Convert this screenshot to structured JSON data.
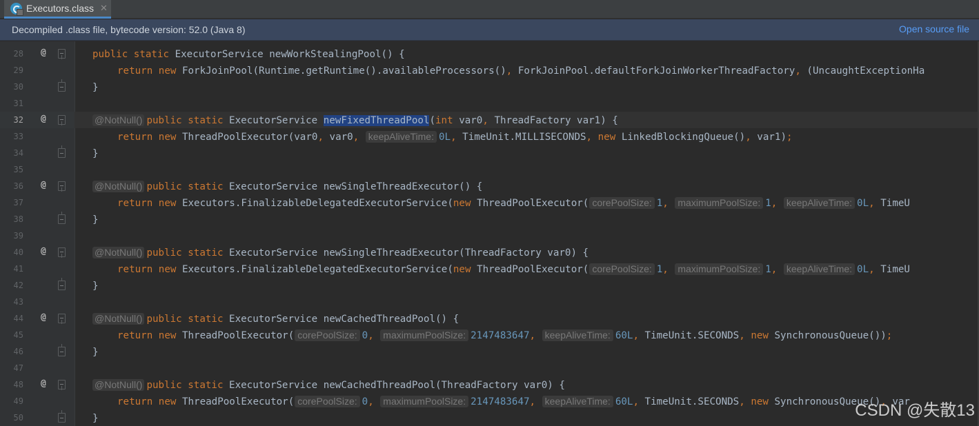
{
  "tab": {
    "title": "Executors.class",
    "close": "✕"
  },
  "banner": {
    "text": "Decompiled .class file, bytecode version: 52.0 (Java 8)",
    "link": "Open source file"
  },
  "watermark": "CSDN @失散13",
  "lines": [
    {
      "n": "28",
      "marker": "@",
      "fold": "open",
      "indent": 0,
      "tokens": [
        {
          "t": "public static ",
          "c": "kw"
        },
        {
          "t": "ExecutorService newWorkStealingPool() {",
          "c": "plain"
        }
      ]
    },
    {
      "n": "29",
      "marker": "",
      "fold": "none",
      "indent": 1,
      "tokens": [
        {
          "t": "return new ",
          "c": "kw"
        },
        {
          "t": "ForkJoinPool(Runtime.getRuntime().availableProcessors()",
          "c": "plain"
        },
        {
          "t": ", ",
          "c": "punct"
        },
        {
          "t": "ForkJoinPool.defaultForkJoinWorkerThreadFactory",
          "c": "plain"
        },
        {
          "t": ", ",
          "c": "punct"
        },
        {
          "t": "(UncaughtExceptionHa",
          "c": "plain"
        }
      ]
    },
    {
      "n": "30",
      "marker": "",
      "fold": "close",
      "indent": 0,
      "tokens": [
        {
          "t": "}",
          "c": "plain"
        }
      ]
    },
    {
      "n": "31",
      "marker": "",
      "fold": "none",
      "indent": 0,
      "tokens": []
    },
    {
      "n": "32",
      "marker": "@",
      "fold": "open",
      "indent": 0,
      "current": true,
      "tokens": [
        {
          "t": "@NotNull()",
          "c": "ann-hint"
        },
        {
          "t": "public static ",
          "c": "kw"
        },
        {
          "t": "ExecutorService ",
          "c": "plain"
        },
        {
          "t": "newFixedThreadPool",
          "c": "sel"
        },
        {
          "t": "(",
          "c": "plain"
        },
        {
          "t": "int ",
          "c": "kw"
        },
        {
          "t": "var0",
          "c": "plain"
        },
        {
          "t": ", ",
          "c": "punct"
        },
        {
          "t": "ThreadFactory var1) {",
          "c": "plain"
        }
      ]
    },
    {
      "n": "33",
      "marker": "",
      "fold": "none",
      "indent": 1,
      "tokens": [
        {
          "t": "return new ",
          "c": "kw"
        },
        {
          "t": "ThreadPoolExecutor(var0",
          "c": "plain"
        },
        {
          "t": ", ",
          "c": "punct"
        },
        {
          "t": "var0",
          "c": "plain"
        },
        {
          "t": ", ",
          "c": "punct"
        },
        {
          "t": "keepAliveTime:",
          "c": "hint"
        },
        {
          "t": "0L",
          "c": "num"
        },
        {
          "t": ", ",
          "c": "punct"
        },
        {
          "t": "TimeUnit.MILLISECONDS",
          "c": "plain"
        },
        {
          "t": ", ",
          "c": "punct"
        },
        {
          "t": "new ",
          "c": "kw"
        },
        {
          "t": "LinkedBlockingQueue()",
          "c": "plain"
        },
        {
          "t": ", ",
          "c": "punct"
        },
        {
          "t": "var1)",
          "c": "plain"
        },
        {
          "t": ";",
          "c": "punct"
        }
      ]
    },
    {
      "n": "34",
      "marker": "",
      "fold": "close",
      "indent": 0,
      "tokens": [
        {
          "t": "}",
          "c": "plain"
        }
      ]
    },
    {
      "n": "35",
      "marker": "",
      "fold": "none",
      "indent": 0,
      "tokens": []
    },
    {
      "n": "36",
      "marker": "@",
      "fold": "open",
      "indent": 0,
      "tokens": [
        {
          "t": "@NotNull()",
          "c": "ann-hint"
        },
        {
          "t": "public static ",
          "c": "kw"
        },
        {
          "t": "ExecutorService newSingleThreadExecutor() {",
          "c": "plain"
        }
      ]
    },
    {
      "n": "37",
      "marker": "",
      "fold": "none",
      "indent": 1,
      "tokens": [
        {
          "t": "return new ",
          "c": "kw"
        },
        {
          "t": "Executors.FinalizableDelegatedExecutorService(",
          "c": "plain"
        },
        {
          "t": "new ",
          "c": "kw"
        },
        {
          "t": "ThreadPoolExecutor(",
          "c": "plain"
        },
        {
          "t": "corePoolSize:",
          "c": "hint"
        },
        {
          "t": "1",
          "c": "num"
        },
        {
          "t": ", ",
          "c": "punct"
        },
        {
          "t": "maximumPoolSize:",
          "c": "hint"
        },
        {
          "t": "1",
          "c": "num"
        },
        {
          "t": ", ",
          "c": "punct"
        },
        {
          "t": "keepAliveTime:",
          "c": "hint"
        },
        {
          "t": "0L",
          "c": "num"
        },
        {
          "t": ", ",
          "c": "punct"
        },
        {
          "t": "TimeU",
          "c": "plain"
        }
      ]
    },
    {
      "n": "38",
      "marker": "",
      "fold": "close",
      "indent": 0,
      "tokens": [
        {
          "t": "}",
          "c": "plain"
        }
      ]
    },
    {
      "n": "39",
      "marker": "",
      "fold": "none",
      "indent": 0,
      "tokens": []
    },
    {
      "n": "40",
      "marker": "@",
      "fold": "open",
      "indent": 0,
      "tokens": [
        {
          "t": "@NotNull()",
          "c": "ann-hint"
        },
        {
          "t": "public static ",
          "c": "kw"
        },
        {
          "t": "ExecutorService newSingleThreadExecutor(ThreadFactory var0) {",
          "c": "plain"
        }
      ]
    },
    {
      "n": "41",
      "marker": "",
      "fold": "none",
      "indent": 1,
      "tokens": [
        {
          "t": "return new ",
          "c": "kw"
        },
        {
          "t": "Executors.FinalizableDelegatedExecutorService(",
          "c": "plain"
        },
        {
          "t": "new ",
          "c": "kw"
        },
        {
          "t": "ThreadPoolExecutor(",
          "c": "plain"
        },
        {
          "t": "corePoolSize:",
          "c": "hint"
        },
        {
          "t": "1",
          "c": "num"
        },
        {
          "t": ", ",
          "c": "punct"
        },
        {
          "t": "maximumPoolSize:",
          "c": "hint"
        },
        {
          "t": "1",
          "c": "num"
        },
        {
          "t": ", ",
          "c": "punct"
        },
        {
          "t": "keepAliveTime:",
          "c": "hint"
        },
        {
          "t": "0L",
          "c": "num"
        },
        {
          "t": ", ",
          "c": "punct"
        },
        {
          "t": "TimeU",
          "c": "plain"
        }
      ]
    },
    {
      "n": "42",
      "marker": "",
      "fold": "close",
      "indent": 0,
      "tokens": [
        {
          "t": "}",
          "c": "plain"
        }
      ]
    },
    {
      "n": "43",
      "marker": "",
      "fold": "none",
      "indent": 0,
      "tokens": []
    },
    {
      "n": "44",
      "marker": "@",
      "fold": "open",
      "indent": 0,
      "tokens": [
        {
          "t": "@NotNull()",
          "c": "ann-hint"
        },
        {
          "t": "public static ",
          "c": "kw"
        },
        {
          "t": "ExecutorService newCachedThreadPool() {",
          "c": "plain"
        }
      ]
    },
    {
      "n": "45",
      "marker": "",
      "fold": "none",
      "indent": 1,
      "tokens": [
        {
          "t": "return new ",
          "c": "kw"
        },
        {
          "t": "ThreadPoolExecutor(",
          "c": "plain"
        },
        {
          "t": "corePoolSize:",
          "c": "hint"
        },
        {
          "t": "0",
          "c": "num"
        },
        {
          "t": ", ",
          "c": "punct"
        },
        {
          "t": "maximumPoolSize:",
          "c": "hint"
        },
        {
          "t": "2147483647",
          "c": "num"
        },
        {
          "t": ", ",
          "c": "punct"
        },
        {
          "t": "keepAliveTime:",
          "c": "hint"
        },
        {
          "t": "60L",
          "c": "num"
        },
        {
          "t": ", ",
          "c": "punct"
        },
        {
          "t": "TimeUnit.SECONDS",
          "c": "plain"
        },
        {
          "t": ", ",
          "c": "punct"
        },
        {
          "t": "new ",
          "c": "kw"
        },
        {
          "t": "SynchronousQueue())",
          "c": "plain"
        },
        {
          "t": ";",
          "c": "punct"
        }
      ]
    },
    {
      "n": "46",
      "marker": "",
      "fold": "close",
      "indent": 0,
      "tokens": [
        {
          "t": "}",
          "c": "plain"
        }
      ]
    },
    {
      "n": "47",
      "marker": "",
      "fold": "none",
      "indent": 0,
      "tokens": []
    },
    {
      "n": "48",
      "marker": "@",
      "fold": "open",
      "indent": 0,
      "tokens": [
        {
          "t": "@NotNull()",
          "c": "ann-hint"
        },
        {
          "t": "public static ",
          "c": "kw"
        },
        {
          "t": "ExecutorService newCachedThreadPool(ThreadFactory var0) {",
          "c": "plain"
        }
      ]
    },
    {
      "n": "49",
      "marker": "",
      "fold": "none",
      "indent": 1,
      "tokens": [
        {
          "t": "return new ",
          "c": "kw"
        },
        {
          "t": "ThreadPoolExecutor(",
          "c": "plain"
        },
        {
          "t": "corePoolSize:",
          "c": "hint"
        },
        {
          "t": "0",
          "c": "num"
        },
        {
          "t": ", ",
          "c": "punct"
        },
        {
          "t": "maximumPoolSize:",
          "c": "hint"
        },
        {
          "t": "2147483647",
          "c": "num"
        },
        {
          "t": ", ",
          "c": "punct"
        },
        {
          "t": "keepAliveTime:",
          "c": "hint"
        },
        {
          "t": "60L",
          "c": "num"
        },
        {
          "t": ", ",
          "c": "punct"
        },
        {
          "t": "TimeUnit.SECONDS",
          "c": "plain"
        },
        {
          "t": ", ",
          "c": "punct"
        },
        {
          "t": "new ",
          "c": "kw"
        },
        {
          "t": "SynchronousQueue()",
          "c": "plain"
        },
        {
          "t": ", ",
          "c": "punct"
        },
        {
          "t": "var",
          "c": "plain"
        }
      ]
    },
    {
      "n": "50",
      "marker": "",
      "fold": "close",
      "indent": 0,
      "tokens": [
        {
          "t": "}",
          "c": "plain"
        }
      ]
    }
  ]
}
